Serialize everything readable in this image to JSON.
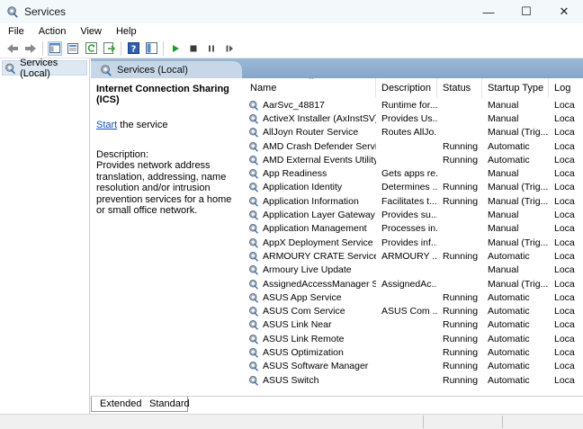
{
  "window": {
    "title": "Services",
    "controls": {
      "minimize": "—",
      "maximize": "☐",
      "close": "✕"
    }
  },
  "menu": [
    "File",
    "Action",
    "View",
    "Help"
  ],
  "toolbar": [
    "back-arrow-icon",
    "forward-arrow-icon",
    "console-tree-icon",
    "properties-icon",
    "refresh-icon",
    "export-list-icon",
    "help-icon",
    "show-hide-icon",
    "start-service-icon",
    "stop-service-icon",
    "pause-service-icon",
    "restart-service-icon"
  ],
  "tree": {
    "root": "Services (Local)"
  },
  "pane": {
    "header": "Services (Local)"
  },
  "details": {
    "service_name": "Internet Connection Sharing (ICS)",
    "start_link": "Start",
    "start_suffix": " the service",
    "description_label": "Description:",
    "description": "Provides network address translation, addressing, name resolution and/or intrusion prevention services for a home or small office network."
  },
  "columns": [
    "Name",
    "Description",
    "Status",
    "Startup Type",
    "Log"
  ],
  "services": [
    [
      "AarSvc_48817",
      "Runtime for...",
      "",
      "Manual",
      "Loca"
    ],
    [
      "ActiveX Installer (AxInstSV)",
      "Provides Us...",
      "",
      "Manual",
      "Loca"
    ],
    [
      "AllJoyn Router Service",
      "Routes AllJo...",
      "",
      "Manual (Trig...",
      "Loca"
    ],
    [
      "AMD Crash Defender Service",
      "",
      "Running",
      "Automatic",
      "Loca"
    ],
    [
      "AMD External Events Utility",
      "",
      "Running",
      "Automatic",
      "Loca"
    ],
    [
      "App Readiness",
      "Gets apps re...",
      "",
      "Manual",
      "Loca"
    ],
    [
      "Application Identity",
      "Determines ...",
      "Running",
      "Manual (Trig...",
      "Loca"
    ],
    [
      "Application Information",
      "Facilitates t...",
      "Running",
      "Manual (Trig...",
      "Loca"
    ],
    [
      "Application Layer Gateway ...",
      "Provides su...",
      "",
      "Manual",
      "Loca"
    ],
    [
      "Application Management",
      "Processes in...",
      "",
      "Manual",
      "Loca"
    ],
    [
      "AppX Deployment Service (...",
      "Provides inf...",
      "",
      "Manual (Trig...",
      "Loca"
    ],
    [
      "ARMOURY CRATE Service",
      "ARMOURY ...",
      "Running",
      "Automatic",
      "Loca"
    ],
    [
      "Armoury Live Update",
      "",
      "",
      "Manual",
      "Loca"
    ],
    [
      "AssignedAccessManager Se...",
      "AssignedAc...",
      "",
      "Manual (Trig...",
      "Loca"
    ],
    [
      "ASUS App Service",
      "",
      "Running",
      "Automatic",
      "Loca"
    ],
    [
      "ASUS Com Service",
      "ASUS Com ...",
      "Running",
      "Automatic",
      "Loca"
    ],
    [
      "ASUS Link Near",
      "",
      "Running",
      "Automatic",
      "Loca"
    ],
    [
      "ASUS Link Remote",
      "",
      "Running",
      "Automatic",
      "Loca"
    ],
    [
      "ASUS Optimization",
      "",
      "Running",
      "Automatic",
      "Loca"
    ],
    [
      "ASUS Software Manager",
      "",
      "Running",
      "Automatic",
      "Loca"
    ],
    [
      "ASUS Switch",
      "",
      "Running",
      "Automatic",
      "Loca"
    ]
  ],
  "tabs": [
    "Extended",
    "Standard"
  ]
}
